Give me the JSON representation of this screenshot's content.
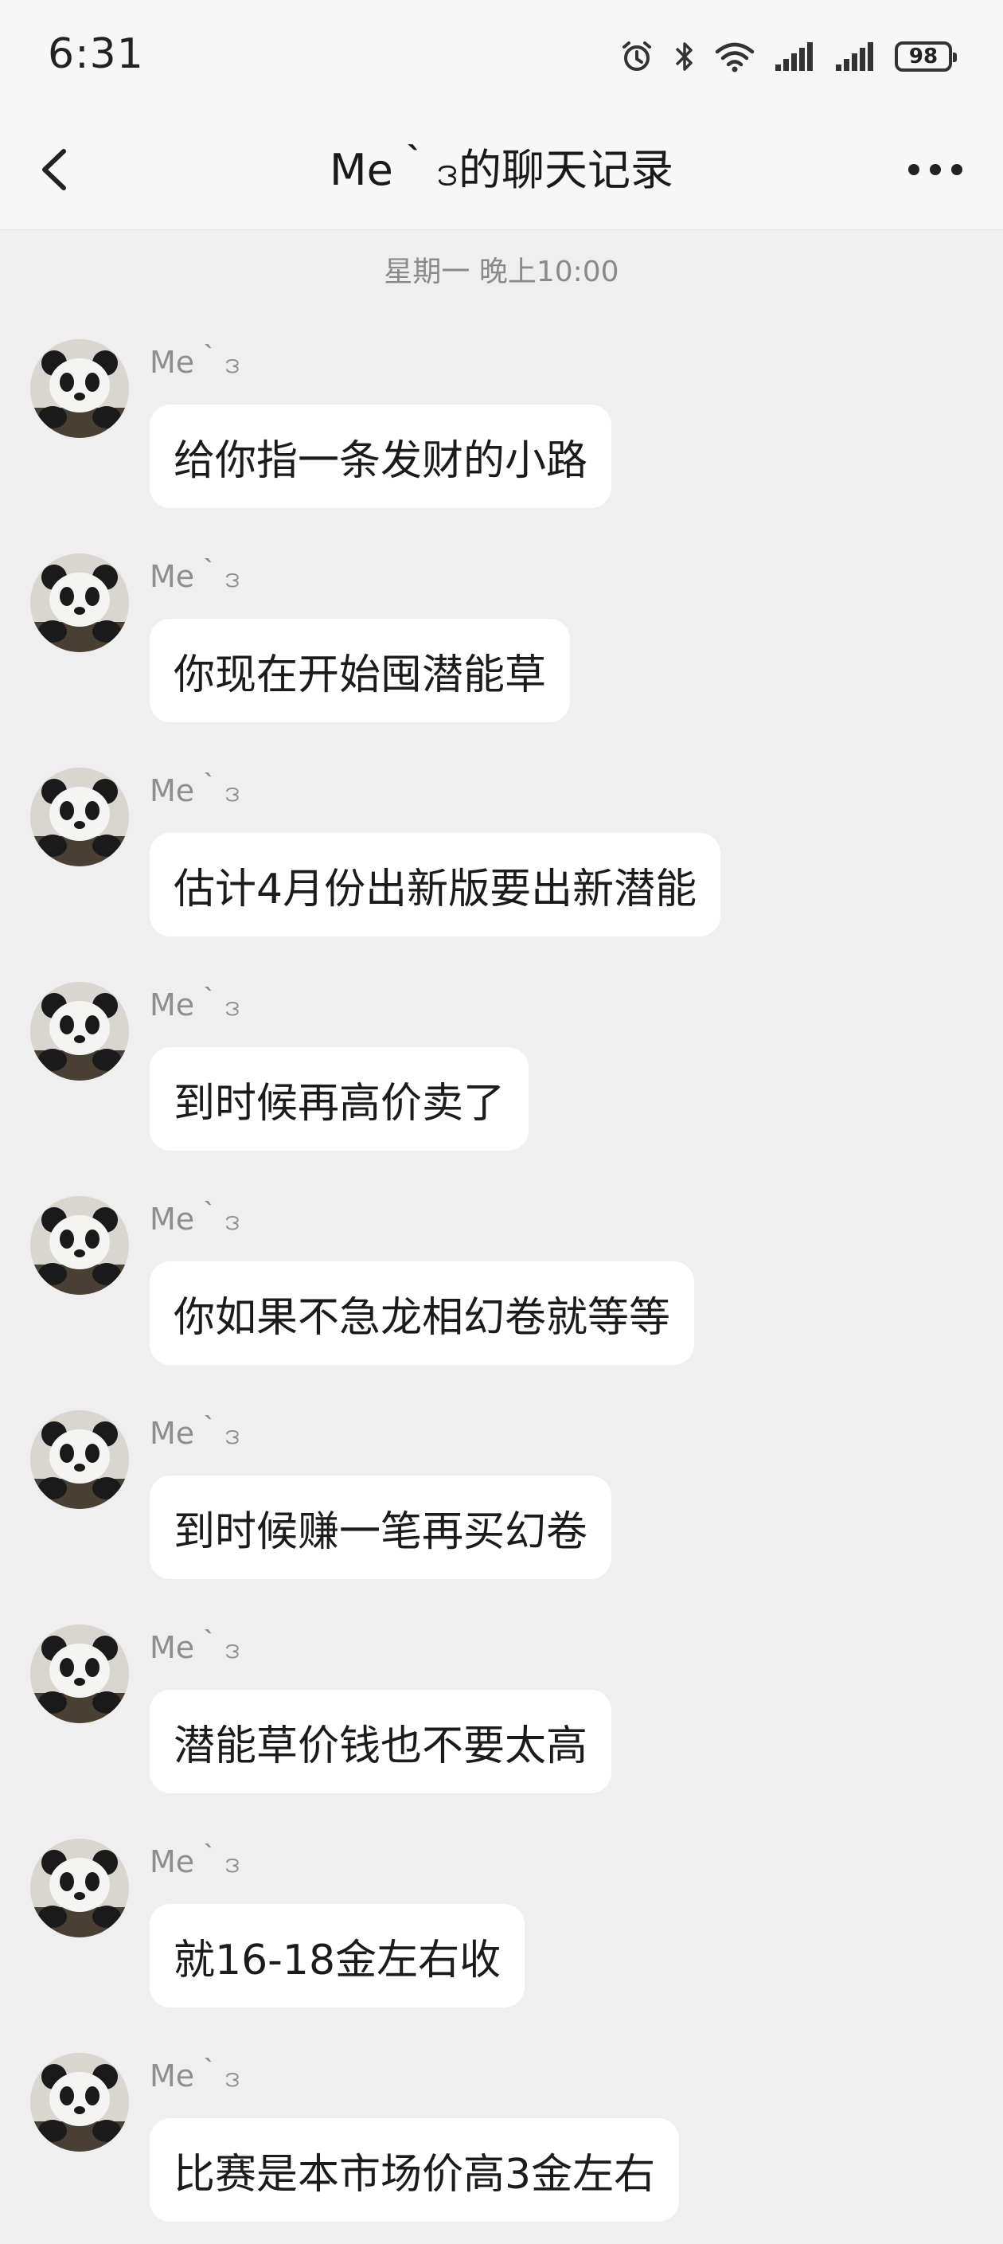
{
  "status_bar": {
    "time": "6:31",
    "battery": "98",
    "icons": [
      "alarm-icon",
      "bluetooth-icon",
      "wifi-icon",
      "signal-icon",
      "signal-icon",
      "battery-icon"
    ]
  },
  "header": {
    "title": "Me｀ဒ的聊天记录",
    "back_icon": "back-chevron-icon",
    "more_icon": "more-dots-icon"
  },
  "chat": {
    "timestamp": "星期一 晚上10:00",
    "messages": [
      {
        "sender": "Me｀ဒ",
        "text": "给你指一条发财的小路"
      },
      {
        "sender": "Me｀ဒ",
        "text": "你现在开始囤潜能草"
      },
      {
        "sender": "Me｀ဒ",
        "text": "估计4月份出新版要出新潜能"
      },
      {
        "sender": "Me｀ဒ",
        "text": "到时候再高价卖了"
      },
      {
        "sender": "Me｀ဒ",
        "text": "你如果不急龙相幻卷就等等"
      },
      {
        "sender": "Me｀ဒ",
        "text": "到时候赚一笔再买幻卷"
      },
      {
        "sender": "Me｀ဒ",
        "text": "潜能草价钱也不要太高"
      },
      {
        "sender": "Me｀ဒ",
        "text": "就16-18金左右收"
      },
      {
        "sender": "Me｀ဒ",
        "text": "比赛是本市场价高3金左右"
      }
    ]
  },
  "colors": {
    "background": "#efefef",
    "bubble": "#ffffff",
    "header": "#f7f7f7",
    "meta_text": "#8a8a8a"
  }
}
